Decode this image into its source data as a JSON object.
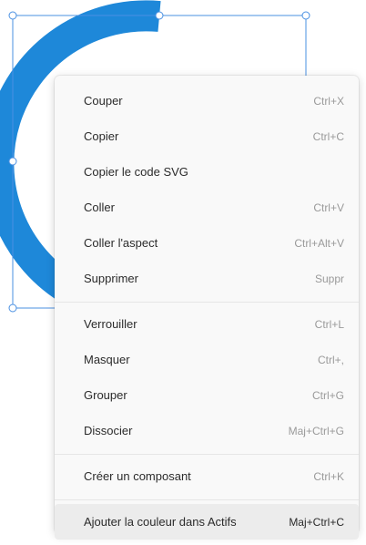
{
  "colors": {
    "arc": "#1e88d9",
    "selection": "#4a90e2",
    "menu_bg": "#f9f9f9",
    "highlight": "#ececec"
  },
  "menu": {
    "groups": [
      {
        "items": [
          {
            "label": "Couper",
            "shortcut": "Ctrl+X"
          },
          {
            "label": "Copier",
            "shortcut": "Ctrl+C"
          },
          {
            "label": "Copier le code SVG",
            "shortcut": ""
          },
          {
            "label": "Coller",
            "shortcut": "Ctrl+V"
          },
          {
            "label": "Coller l'aspect",
            "shortcut": "Ctrl+Alt+V"
          },
          {
            "label": "Supprimer",
            "shortcut": "Suppr"
          }
        ]
      },
      {
        "items": [
          {
            "label": "Verrouiller",
            "shortcut": "Ctrl+L"
          },
          {
            "label": "Masquer",
            "shortcut": "Ctrl+,"
          },
          {
            "label": "Grouper",
            "shortcut": "Ctrl+G"
          },
          {
            "label": "Dissocier",
            "shortcut": "Maj+Ctrl+G"
          }
        ]
      },
      {
        "items": [
          {
            "label": "Créer un composant",
            "shortcut": "Ctrl+K"
          }
        ]
      },
      {
        "items": [
          {
            "label": "Ajouter la couleur dans Actifs",
            "shortcut": "Maj+Ctrl+C",
            "highlighted": true
          }
        ]
      }
    ]
  }
}
